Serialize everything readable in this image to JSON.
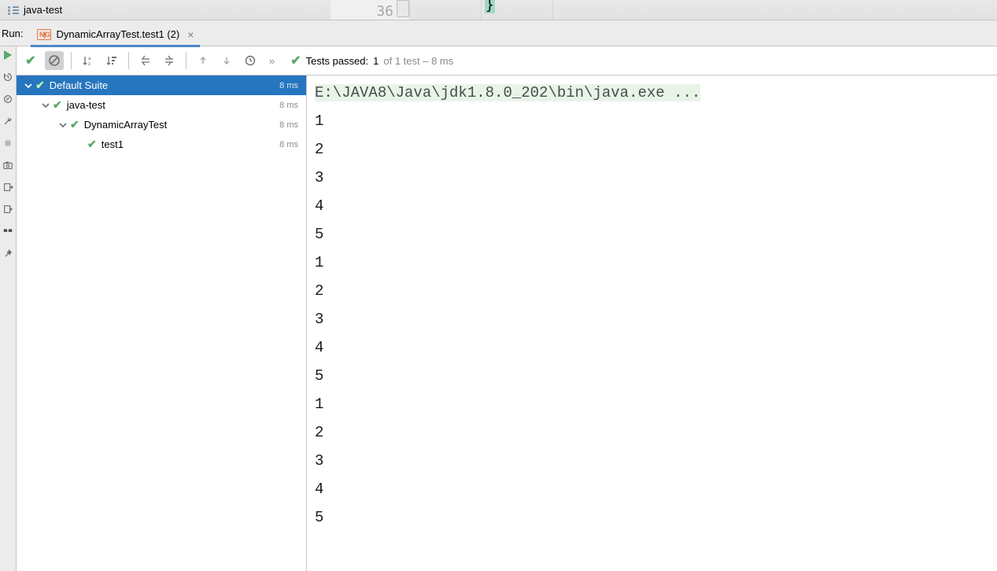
{
  "top": {
    "project_tab": "java-test",
    "line_no": "36",
    "bracket": "}"
  },
  "run": {
    "label": "Run:",
    "tab": "DynamicArrayTest.test1 (2)",
    "ng": "N|G"
  },
  "status": {
    "passed_label": "Tests passed:",
    "passed_n": "1",
    "of_part": " of 1 test – 8 ms"
  },
  "tree": [
    {
      "depth": 0,
      "expander": true,
      "ok": true,
      "label": "Default Suite",
      "time": "8 ms",
      "sel": true
    },
    {
      "depth": 1,
      "expander": true,
      "ok": true,
      "label": "java-test",
      "time": "8 ms",
      "sel": false
    },
    {
      "depth": 2,
      "expander": true,
      "ok": true,
      "label": "DynamicArrayTest",
      "time": "8 ms",
      "sel": false
    },
    {
      "depth": 3,
      "expander": false,
      "ok": true,
      "label": "test1",
      "time": "8 ms",
      "sel": false
    }
  ],
  "console": {
    "cmd": "E:\\JAVA8\\Java\\jdk1.8.0_202\\bin\\java.exe ...",
    "lines": [
      "1",
      "2",
      "3",
      "4",
      "5",
      "1",
      "2",
      "3",
      "4",
      "5",
      "1",
      "2",
      "3",
      "4",
      "5"
    ]
  }
}
